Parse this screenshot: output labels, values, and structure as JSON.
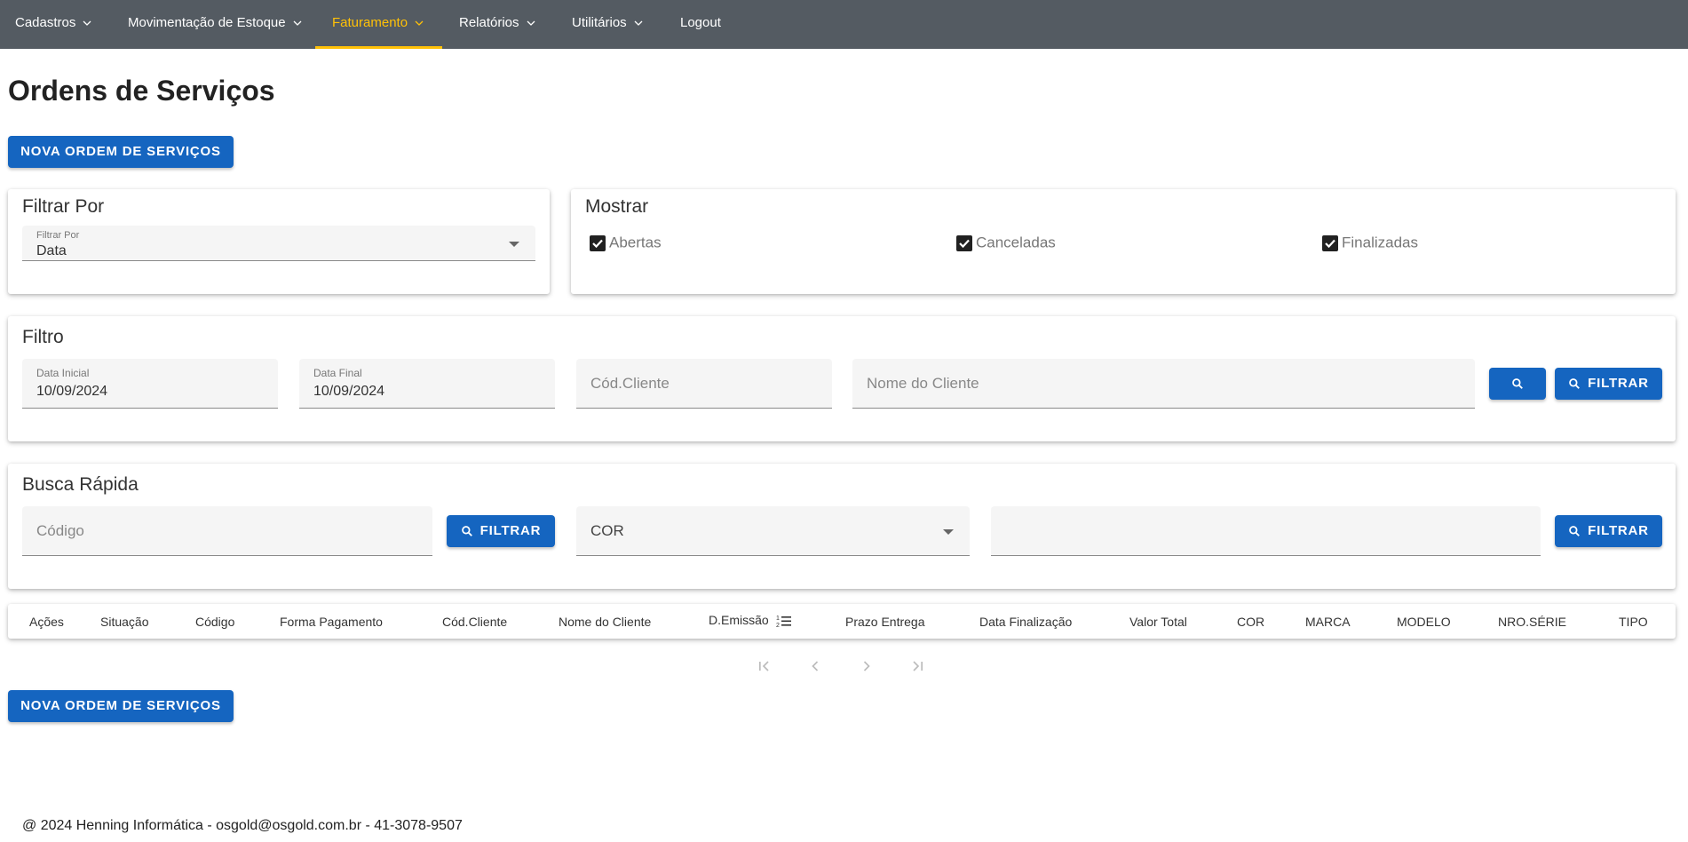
{
  "nav": {
    "items": [
      {
        "label": "Cadastros"
      },
      {
        "label": "Movimentação de Estoque"
      },
      {
        "label": "Faturamento"
      },
      {
        "label": "Relatórios"
      },
      {
        "label": "Utilitários"
      },
      {
        "label": "Logout"
      }
    ],
    "active": "Faturamento",
    "accent_color": "#ffc107",
    "bar_color": "#545b62"
  },
  "page": {
    "title": "Ordens de Serviços"
  },
  "actions": {
    "new_order_label": "NOVA ORDEM DE SERVIÇOS",
    "new_order_bottom_label": "NOVA ORDEM DE SERVIÇOS"
  },
  "filter_by": {
    "title": "Filtrar Por",
    "select_label": "Filtrar Por",
    "select_value": "Data"
  },
  "show": {
    "title": "Mostrar",
    "options": [
      {
        "label": "Abertas",
        "checked": true
      },
      {
        "label": "Canceladas",
        "checked": true
      },
      {
        "label": "Finalizadas",
        "checked": true
      }
    ]
  },
  "filter": {
    "title": "Filtro",
    "start_label": "Data Inicial",
    "start_value": "10/09/2024",
    "end_label": "Data Final",
    "end_value": "10/09/2024",
    "client_code_placeholder": "Cód.Cliente",
    "client_name_placeholder": "Nome do Cliente",
    "filter_button": "FILTRAR"
  },
  "quick_search": {
    "title": "Busca Rápida",
    "code_placeholder": "Código",
    "filter_button": "FILTRAR",
    "field_select_value": "COR",
    "filter_button_2": "FILTRAR"
  },
  "table": {
    "columns": [
      "Ações",
      "Situação",
      "Código",
      "Forma Pagamento",
      "Cód.Cliente",
      "Nome do Cliente",
      "D.Emissão",
      "Prazo Entrega",
      "Data Finalização",
      "Valor Total",
      "COR",
      "MARCA",
      "MODELO",
      "NRO.SÉRIE",
      "TIPO"
    ]
  },
  "footer": {
    "text": "@ 2024 Henning Informática - osgold@osgold.com.br - 41-3078-9507"
  },
  "colors": {
    "primary": "#1565c0"
  }
}
